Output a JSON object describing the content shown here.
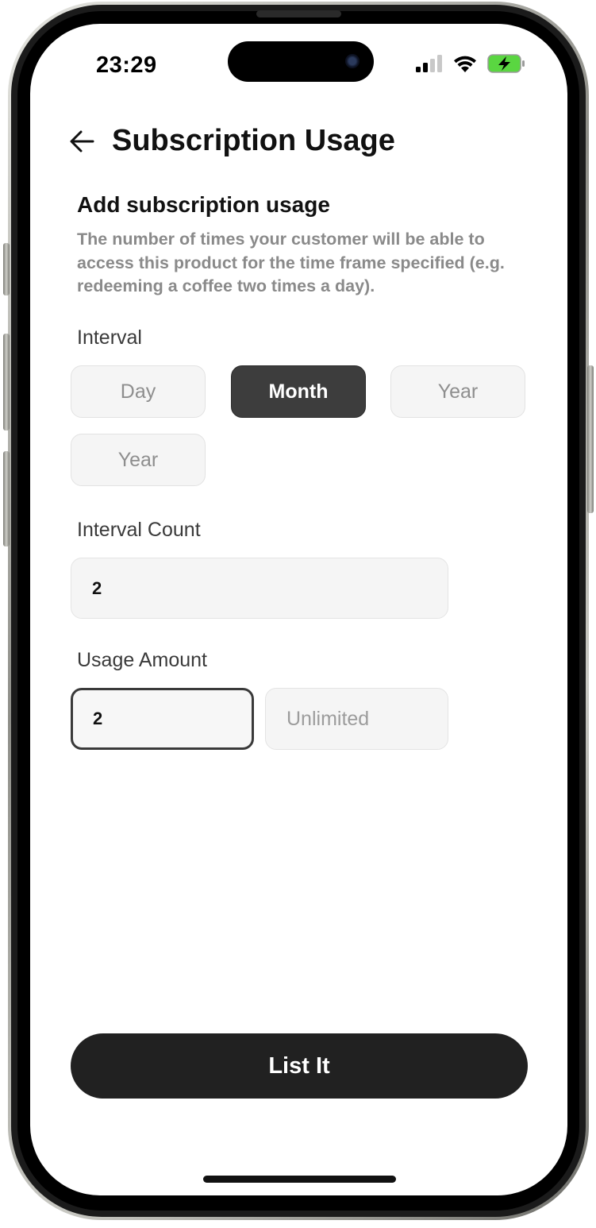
{
  "status_bar": {
    "time": "23:29",
    "icons": [
      "signal-icon",
      "wifi-icon",
      "battery-charging-icon"
    ]
  },
  "header": {
    "back_icon": "arrow-left-icon",
    "title": "Subscription Usage"
  },
  "section": {
    "title": "Add subscription usage",
    "description": "The number of times your customer will be able to access this product for the time frame specified (e.g. redeeming a coffee two times a day)."
  },
  "interval": {
    "label": "Interval",
    "options": [
      {
        "label": "Day",
        "selected": false
      },
      {
        "label": "Month",
        "selected": true
      },
      {
        "label": "Year",
        "selected": false
      },
      {
        "label": "Year",
        "selected": false
      }
    ]
  },
  "interval_count": {
    "label": "Interval Count",
    "value": "2"
  },
  "usage_amount": {
    "label": "Usage Amount",
    "value": "2",
    "unlimited_label": "Unlimited"
  },
  "primary_action": {
    "label": "List It"
  },
  "colors": {
    "selected_chip": "#3d3d3d",
    "primary_button": "#212121",
    "battery_fill": "#5ad641"
  }
}
